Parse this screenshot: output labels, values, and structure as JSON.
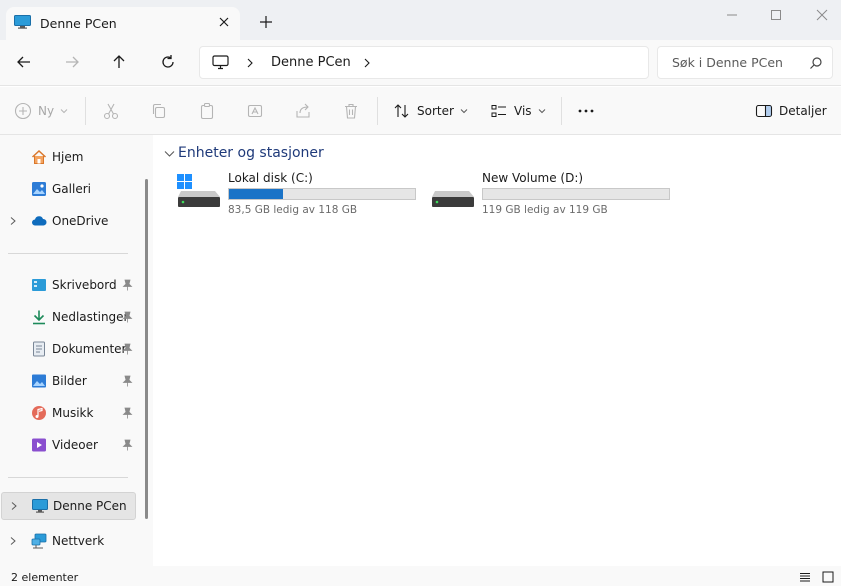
{
  "tab": {
    "title": "Denne PCen",
    "icon": "computer-icon"
  },
  "window": {
    "minimize": "minimize-icon",
    "maximize": "maximize-icon",
    "close": "close-icon"
  },
  "address": {
    "path": "Denne PCen"
  },
  "search": {
    "placeholder": "Søk i Denne PCen"
  },
  "toolbar": {
    "new_label": "Ny",
    "sort_label": "Sorter",
    "view_label": "Vis",
    "details_label": "Detaljer"
  },
  "sidebar": {
    "items": [
      {
        "label": "Hjem",
        "icon": "home-icon"
      },
      {
        "label": "Galleri",
        "icon": "gallery-icon"
      },
      {
        "label": "OneDrive",
        "icon": "cloud-icon"
      },
      {
        "label": "Skrivebord",
        "icon": "desktop-icon"
      },
      {
        "label": "Nedlastinger",
        "icon": "download-icon"
      },
      {
        "label": "Dokumenter",
        "icon": "document-icon"
      },
      {
        "label": "Bilder",
        "icon": "pictures-icon"
      },
      {
        "label": "Musikk",
        "icon": "music-icon"
      },
      {
        "label": "Videoer",
        "icon": "video-icon"
      },
      {
        "label": "Denne PCen",
        "icon": "computer-icon"
      },
      {
        "label": "Nettverk",
        "icon": "network-icon"
      }
    ]
  },
  "main": {
    "group_title": "Enheter og stasjoner",
    "drives": [
      {
        "name": "Lokal disk (C:)",
        "free": "83,5 GB ledig av 118 GB",
        "used_fraction": 0.29
      },
      {
        "name": "New Volume (D:)",
        "free": "119 GB ledig av 119 GB",
        "used_fraction": 0.0
      }
    ]
  },
  "status": {
    "count": "2 elementer"
  },
  "colors": {
    "accent": "#1a73c7",
    "group_title": "#1f3a7a",
    "folder_blue": "#2d7cd6"
  }
}
